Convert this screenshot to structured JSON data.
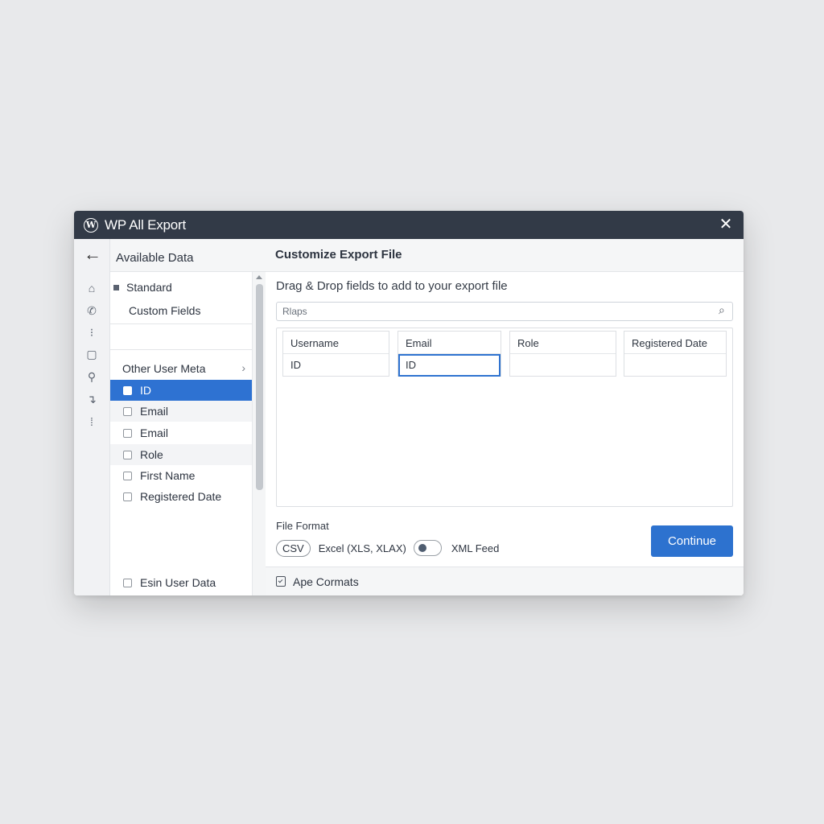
{
  "window": {
    "title": "WP All Export",
    "close_glyph": "✕"
  },
  "rail": {
    "back_glyph": "←",
    "icons": [
      {
        "name": "home-icon",
        "glyph": "⌂"
      },
      {
        "name": "phone-icon",
        "glyph": "✆"
      },
      {
        "name": "grid-icon",
        "glyph": "⁝"
      },
      {
        "name": "square-icon",
        "glyph": "▢"
      },
      {
        "name": "search-user-icon",
        "glyph": "⚲"
      },
      {
        "name": "corner-icon",
        "glyph": "↴"
      },
      {
        "name": "dots-icon",
        "glyph": "⁞"
      }
    ]
  },
  "available": {
    "header": "Available Data",
    "categories": [
      "Standard",
      "Custom Fields"
    ],
    "other_meta": "Other User Meta",
    "chevron": "›",
    "fields": [
      "ID",
      "Email",
      "Email",
      "Role",
      "First Name",
      "Registered Date"
    ],
    "bottom_item": "Esin User Data"
  },
  "main": {
    "header": "Customize Export File",
    "subtitle": "Drag & Drop fields to add to your export file",
    "search": {
      "value": "Rlaps",
      "icon": "⌕"
    },
    "columns": [
      {
        "header": "Username",
        "value": "ID"
      },
      {
        "header": "Email",
        "value": "ID"
      },
      {
        "header": "Role",
        "value": ""
      },
      {
        "header": "Registered Date",
        "value": ""
      }
    ],
    "file_format": {
      "label": "File Format",
      "csv": "CSV",
      "excel": "Excel (XLS, XLAX)",
      "xml": "XML Feed"
    },
    "continue_label": "Continue",
    "footer": "Ape Cormats"
  },
  "colors": {
    "titlebar": "#323a47",
    "accent": "#2e72d2",
    "background": "#e8e9eb"
  }
}
